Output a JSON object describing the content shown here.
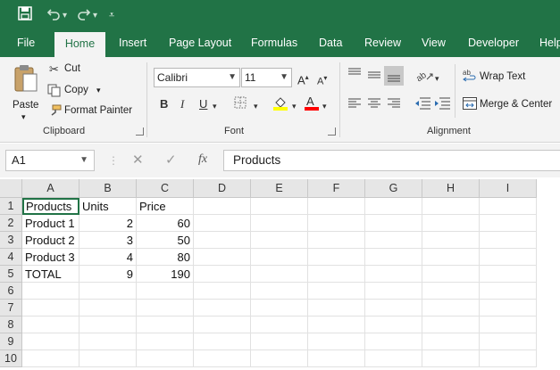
{
  "quick_access": {
    "save_icon": "save-icon",
    "undo_icon": "undo-icon",
    "redo_icon": "redo-icon",
    "customize_icon": "customize-icon"
  },
  "tabs": [
    "File",
    "Home",
    "Insert",
    "Page Layout",
    "Formulas",
    "Data",
    "Review",
    "View",
    "Developer",
    "Help"
  ],
  "active_tab": "Home",
  "clipboard": {
    "paste": "Paste",
    "cut": "Cut",
    "copy": "Copy",
    "format_painter": "Format Painter",
    "group": "Clipboard"
  },
  "font": {
    "name": "Calibri",
    "size": "11",
    "bold": "B",
    "italic": "I",
    "underline": "U",
    "group": "Font",
    "fill_color": "#ffff00",
    "font_color": "#ff0000"
  },
  "alignment": {
    "wrap_text": "Wrap Text",
    "merge_center": "Merge & Center",
    "group": "Alignment"
  },
  "name_box": "A1",
  "formula_bar": {
    "fx": "fx",
    "content": "Products"
  },
  "columns": [
    "A",
    "B",
    "C",
    "D",
    "E",
    "F",
    "G",
    "H",
    "I"
  ],
  "rows": [
    "1",
    "2",
    "3",
    "4",
    "5",
    "6",
    "7",
    "8",
    "9",
    "10"
  ],
  "cells": [
    [
      "Products",
      "Units",
      "Price"
    ],
    [
      "Product 1",
      "2",
      "60"
    ],
    [
      "Product 2",
      "3",
      "50"
    ],
    [
      "Product 3",
      "4",
      "80"
    ],
    [
      "TOTAL",
      "9",
      "190"
    ]
  ],
  "theme": {
    "accent": "#217346"
  }
}
